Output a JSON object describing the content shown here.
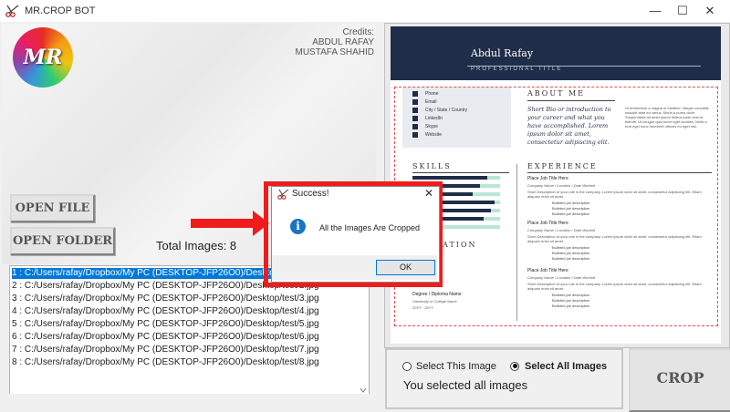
{
  "window": {
    "title": "MR.CROP BOT",
    "controls": {
      "minimize": "—",
      "maximize": "☐",
      "close": "✕"
    }
  },
  "logo": {
    "text": "MR"
  },
  "credits": {
    "heading": "Credits:",
    "names": [
      "ABDUL RAFAY",
      "MUSTAFA SHAHID"
    ]
  },
  "buttons": {
    "open_file": "OPEN FILE",
    "open_folder": "OPEN FOLDER",
    "crop": "CROP"
  },
  "total_images": "Total Images: 8",
  "file_list": {
    "selected_index": 0,
    "items": [
      "1 : C:/Users/rafay/Dropbox/My PC (DESKTOP-JFP26O0)/Desktop/test/1.jpg",
      "2 : C:/Users/rafay/Dropbox/My PC (DESKTOP-JFP26O0)/Desktop/test/2.jpg",
      "3 : C:/Users/rafay/Dropbox/My PC (DESKTOP-JFP26O0)/Desktop/test/3.jpg",
      "4 : C:/Users/rafay/Dropbox/My PC (DESKTOP-JFP26O0)/Desktop/test/4.jpg",
      "5 : C:/Users/rafay/Dropbox/My PC (DESKTOP-JFP26O0)/Desktop/test/5.jpg",
      "6 : C:/Users/rafay/Dropbox/My PC (DESKTOP-JFP26O0)/Desktop/test/6.jpg",
      "7 : C:/Users/rafay/Dropbox/My PC (DESKTOP-JFP26O0)/Desktop/test/7.jpg",
      "8 : C:/Users/rafay/Dropbox/My PC (DESKTOP-JFP26O0)/Desktop/test/8.jpg"
    ]
  },
  "dialog": {
    "title": "Success!",
    "message": "All the Images Are Cropped",
    "ok": "OK",
    "close": "✕",
    "icon": "info-icon"
  },
  "resume": {
    "name": "Abdul Rafay",
    "title": "PROFESSIONAL TITLE",
    "contact": [
      "Phone",
      "Email",
      "City / State / Country",
      "LinkedIn",
      "Skype",
      "Website"
    ],
    "about_heading": "ABOUT ME",
    "about_text": "Short Bio or introduction to your career and what you have accomplished. Lorem ipsum dolor sit amet, consectetur adipiscing elit.",
    "about_fine": "Ut fermentum a magna ut eleifend. Integer convallis suscipit ante eu varius. Morbi a purus dolor. Suspendisse sit amet ipsum finibus justo viverra blandit. Ut congue quis tortor eget sodales. Nulla a erat eget nunc hendrerit ultrices eu eget nisi.",
    "skills_heading": "SKILLS",
    "education_heading": "EDUCATION",
    "experience_heading": "EXPERIENCE",
    "jobs": [
      {
        "title": "Place Job Title Here",
        "sub": "Company Name / Location / Date Worked"
      },
      {
        "title": "Place Job Title Here",
        "sub": "Company Name / Location / Date Worked"
      },
      {
        "title": "Place Job Title Here",
        "sub": "Company Name / Location / Date Worked"
      }
    ],
    "job_text": "Short Description of your role in the company. Lorem ipsum dolor sit amet, consectetur adipiscing elit. Etiam aliquam enim sit amet.",
    "bullet": "Bulleted job description",
    "degree": "Degree / Diploma Name",
    "school": "University or College Name",
    "years": "20YY - 20YY"
  },
  "radio": {
    "option1": "Select This Image",
    "option2": "Select All Images",
    "selected": "option2"
  },
  "selection_status": "You selected all images",
  "colors": {
    "accent_red": "#ee1c1c",
    "selection_blue": "#0078d7",
    "resume_navy": "#1f2d48"
  }
}
